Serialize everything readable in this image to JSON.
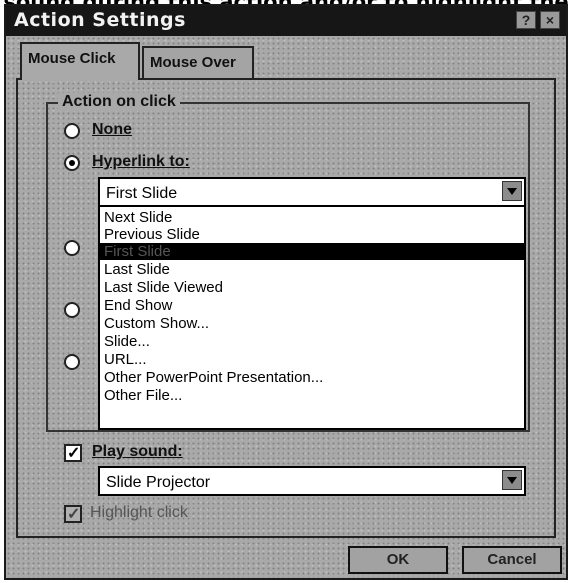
{
  "caption_fragment": "sound during this action and/or to highlight the",
  "window": {
    "title": "Action Settings",
    "help_glyph": "?",
    "close_glyph": "×"
  },
  "tabs": [
    {
      "label": "Mouse Click",
      "active": true
    },
    {
      "label": "Mouse Over",
      "active": false
    }
  ],
  "action_group": {
    "legend": "Action on click",
    "options": [
      {
        "label": "None",
        "checked": false
      },
      {
        "label": "Hyperlink to:",
        "checked": true
      }
    ]
  },
  "hyperlink_combo": {
    "value": "First Slide"
  },
  "hyperlink_options": [
    "Next Slide",
    "Previous Slide",
    "First Slide",
    "Last Slide",
    "Last Slide Viewed",
    "End Show",
    "Custom Show...",
    "Slide...",
    "URL...",
    "Other PowerPoint Presentation...",
    "Other File..."
  ],
  "selected_option_index": 2,
  "play_sound": {
    "label": "Play sound:",
    "checked": true,
    "value": "Slide Projector"
  },
  "highlight_click": {
    "label": "Highlight click",
    "checked": true,
    "enabled": false
  },
  "buttons": {
    "ok": "OK",
    "cancel": "Cancel"
  }
}
